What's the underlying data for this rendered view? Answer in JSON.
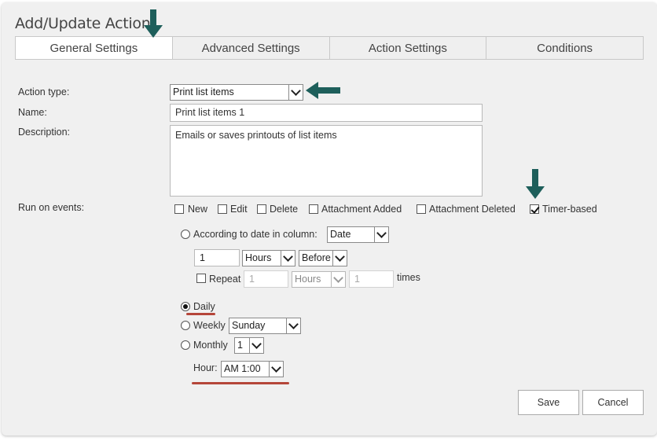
{
  "title": "Add/Update Action",
  "tabs": [
    {
      "label": "General Settings",
      "active": true
    },
    {
      "label": "Advanced Settings",
      "active": false
    },
    {
      "label": "Action Settings",
      "active": false
    },
    {
      "label": "Conditions",
      "active": false
    }
  ],
  "form": {
    "action_type_label": "Action type:",
    "action_type_value": "Print list items",
    "name_label": "Name:",
    "name_value": "Print list items 1",
    "description_label": "Description:",
    "description_value": "Emails or saves printouts of list items",
    "run_on_events_label": "Run on events:"
  },
  "events": [
    {
      "label": "New",
      "checked": false
    },
    {
      "label": "Edit",
      "checked": false
    },
    {
      "label": "Delete",
      "checked": false
    },
    {
      "label": "Attachment Added",
      "checked": false
    },
    {
      "label": "Attachment Deleted",
      "checked": false
    },
    {
      "label": "Timer-based",
      "checked": true
    }
  ],
  "timer": {
    "date_column_label": "According to date in column:",
    "date_column_value": "Date",
    "offset_value": "1",
    "offset_unit": "Hours",
    "offset_direction": "Before",
    "repeat_label": "Repeat",
    "repeat_value": "1",
    "repeat_unit": "Hours",
    "repeat_times_value": "1",
    "times_label": "times",
    "daily_label": "Daily",
    "weekly_label": "Weekly",
    "weekly_value": "Sunday",
    "monthly_label": "Monthly",
    "monthly_value": "1",
    "hour_label": "Hour:",
    "hour_value": "AM 1:00",
    "selected_schedule": "Daily"
  },
  "buttons": {
    "save": "Save",
    "cancel": "Cancel"
  },
  "colors": {
    "arrow": "#1e5f5b",
    "underline": "#b5463a"
  }
}
